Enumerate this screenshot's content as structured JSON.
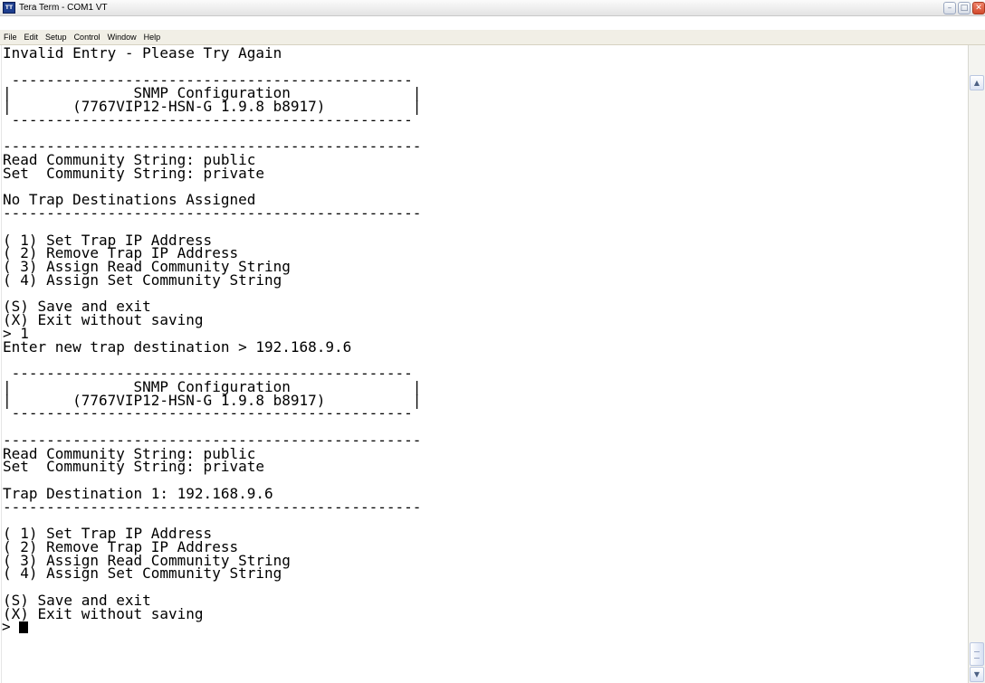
{
  "window": {
    "title": "Tera Term - COM1 VT",
    "app_icon_text": "TT",
    "controls": {
      "minimize": "–",
      "maximize": "□",
      "close": "✕"
    }
  },
  "menu": [
    "File",
    "Edit",
    "Setup",
    "Control",
    "Window",
    "Help"
  ],
  "terminal": {
    "lines": [
      "Invalid Entry - Please Try Again",
      "",
      " ---------------------------------------------- ",
      "|              SNMP Configuration              |",
      "|       (7767VIP12-HSN-G 1.9.8 b8917)          |",
      " ---------------------------------------------- ",
      "",
      "------------------------------------------------",
      "Read Community String: public",
      "Set  Community String: private",
      "",
      "No Trap Destinations Assigned",
      "------------------------------------------------",
      "",
      "( 1) Set Trap IP Address",
      "( 2) Remove Trap IP Address",
      "( 3) Assign Read Community String",
      "( 4) Assign Set Community String",
      "",
      "(S) Save and exit",
      "(X) Exit without saving",
      "> 1",
      "Enter new trap destination > 192.168.9.6",
      "",
      " ---------------------------------------------- ",
      "|              SNMP Configuration              |",
      "|       (7767VIP12-HSN-G 1.9.8 b8917)          |",
      " ---------------------------------------------- ",
      "",
      "------------------------------------------------",
      "Read Community String: public",
      "Set  Community String: private",
      "",
      "Trap Destination 1: 192.168.9.6",
      "------------------------------------------------",
      "",
      "( 1) Set Trap IP Address",
      "( 2) Remove Trap IP Address",
      "( 3) Assign Read Community String",
      "( 4) Assign Set Community String",
      "",
      "(S) Save and exit",
      "(X) Exit without saving"
    ],
    "prompt": "> "
  },
  "scrollbar": {
    "up_arrow": "▲",
    "down_arrow": "▼"
  }
}
